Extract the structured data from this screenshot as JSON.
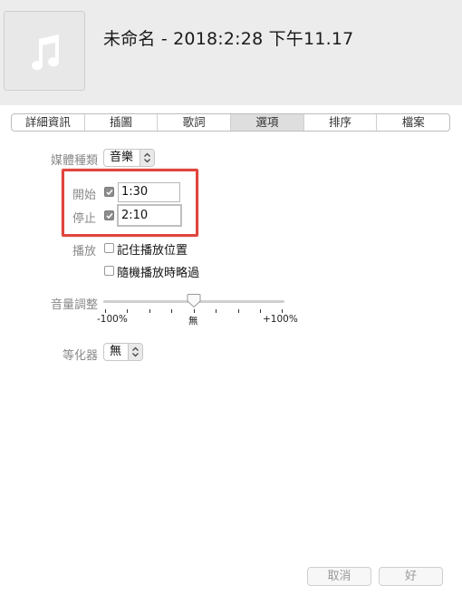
{
  "header": {
    "title": "未命名 - 2018:2:28 下午11.17",
    "artwork_icon": "music-note-icon"
  },
  "tabs": [
    {
      "label": "詳細資訊",
      "active": false
    },
    {
      "label": "插圖",
      "active": false
    },
    {
      "label": "歌詞",
      "active": false
    },
    {
      "label": "選項",
      "active": true
    },
    {
      "label": "排序",
      "active": false
    },
    {
      "label": "檔案",
      "active": false
    }
  ],
  "options": {
    "media_kind": {
      "label": "媒體種類",
      "value": "音樂"
    },
    "start": {
      "label": "開始",
      "checked": true,
      "value": "1:30"
    },
    "stop": {
      "label": "停止",
      "checked": true,
      "value": "2:10"
    },
    "playback": {
      "label": "播放",
      "remember_position": {
        "label": "記住播放位置",
        "checked": false
      },
      "skip_shuffle": {
        "label": "隨機播放時略過",
        "checked": false
      }
    },
    "volume": {
      "label": "音量調整",
      "value_percent": 0,
      "min_label": "-100%",
      "mid_label": "無",
      "max_label": "+100%"
    },
    "equalizer": {
      "label": "等化器",
      "value": "無"
    }
  },
  "footer": {
    "cancel_label": "取消",
    "ok_label": "好"
  },
  "colors": {
    "highlight": "#e0453e",
    "header_bg": "#ececec"
  }
}
